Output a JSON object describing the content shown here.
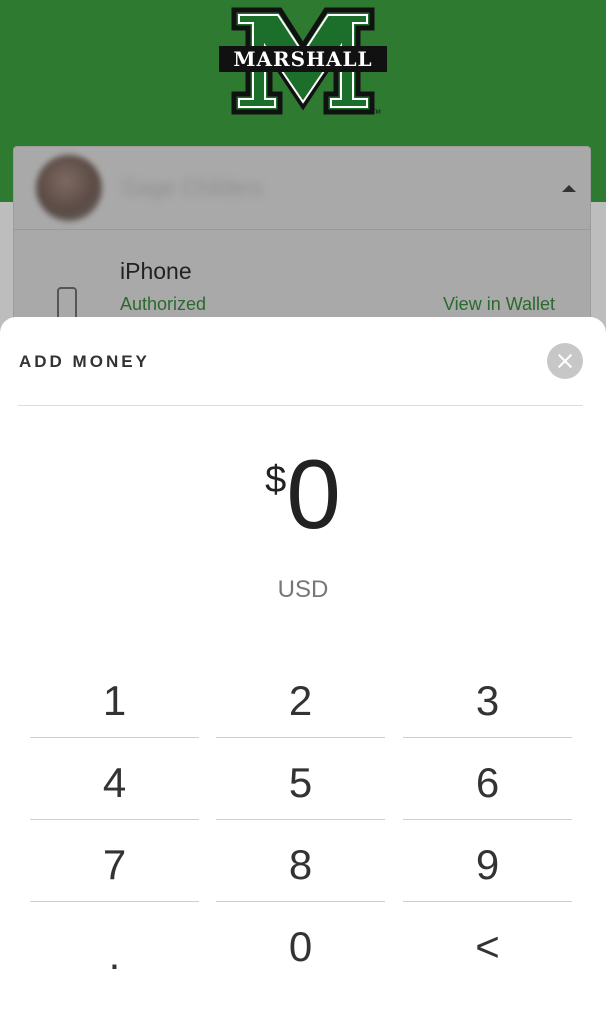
{
  "header": {
    "logo_text": "MARSHALL",
    "brand_color": "#2f7a31"
  },
  "account": {
    "name": "Gage Childers"
  },
  "device": {
    "name": "iPhone",
    "status": "Authorized",
    "wallet_link": "View in Wallet"
  },
  "sheet": {
    "title": "ADD MONEY",
    "close_icon": "close-icon",
    "currency_symbol": "$",
    "amount": "0",
    "currency_code": "USD"
  },
  "keypad": {
    "keys": [
      "1",
      "2",
      "3",
      "4",
      "5",
      "6",
      "7",
      "8",
      "9",
      ".",
      "0",
      "<"
    ]
  }
}
